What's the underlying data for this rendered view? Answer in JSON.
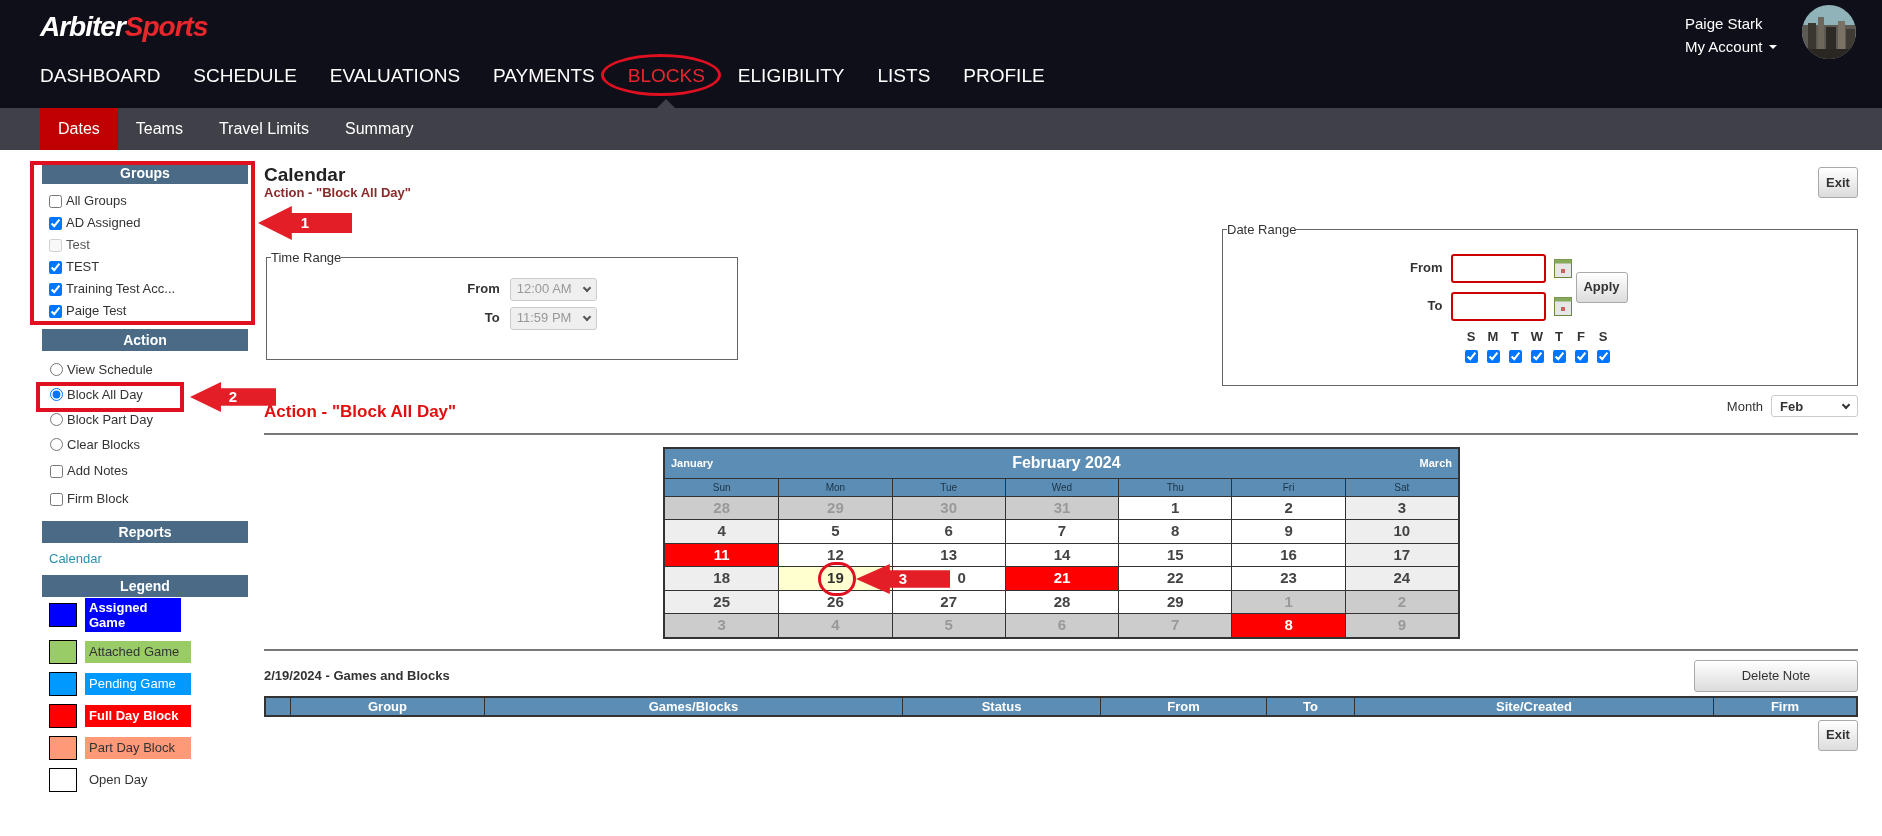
{
  "header": {
    "logo": {
      "first": "Arbiter",
      "second": "Sports"
    },
    "nav": [
      {
        "label": "DASHBOARD",
        "selected": false
      },
      {
        "label": "SCHEDULE",
        "selected": false
      },
      {
        "label": "EVALUATIONS",
        "selected": false
      },
      {
        "label": "PAYMENTS",
        "selected": false
      },
      {
        "label": "BLOCKS",
        "selected": true
      },
      {
        "label": "ELIGIBILITY",
        "selected": false
      },
      {
        "label": "LISTS",
        "selected": false
      },
      {
        "label": "PROFILE",
        "selected": false
      }
    ],
    "user": {
      "name": "Paige Stark",
      "account": "My Account"
    }
  },
  "subnav": [
    {
      "label": "Dates",
      "selected": true
    },
    {
      "label": "Teams",
      "selected": false
    },
    {
      "label": "Travel Limits",
      "selected": false
    },
    {
      "label": "Summary",
      "selected": false
    }
  ],
  "sidebar": {
    "groups": {
      "title": "Groups",
      "items": [
        {
          "label": "All Groups",
          "checked": false,
          "disabled": false
        },
        {
          "label": "AD Assigned",
          "checked": true,
          "disabled": false
        },
        {
          "label": "Test",
          "checked": false,
          "disabled": true
        },
        {
          "label": "TEST",
          "checked": true,
          "disabled": false
        },
        {
          "label": "Training Test Acc...",
          "checked": true,
          "disabled": false
        },
        {
          "label": "Paige Test",
          "checked": true,
          "disabled": false
        }
      ]
    },
    "action": {
      "title": "Action",
      "items": [
        {
          "kind": "radio",
          "label": "View Schedule",
          "selected": false
        },
        {
          "kind": "radio",
          "label": "Block All Day",
          "selected": true
        },
        {
          "kind": "radio",
          "label": "Block Part Day",
          "selected": false
        },
        {
          "kind": "radio",
          "label": "Clear Blocks",
          "selected": false
        },
        {
          "kind": "checkbox",
          "label": "Add Notes",
          "checked": false
        },
        {
          "kind": "checkbox",
          "label": "Firm Block",
          "checked": false
        }
      ]
    },
    "reports": {
      "title": "Reports",
      "links": [
        "Calendar"
      ]
    },
    "legend": {
      "title": "Legend",
      "items": [
        {
          "label": "Assigned Game",
          "color": "#0000ff"
        },
        {
          "label": "Attached Game",
          "color": "#99cc66"
        },
        {
          "label": "Pending Game",
          "color": "#0099ff"
        },
        {
          "label": "Full Day Block",
          "color": "#ff0000"
        },
        {
          "label": "Part Day Block",
          "color": "#ff9977"
        },
        {
          "label": "Open Day",
          "color": "#ffffff"
        }
      ]
    }
  },
  "main": {
    "title": "Calendar",
    "subtitle": "Action - \"Block All Day\"",
    "exit": "Exit",
    "time_range": {
      "legend": "Time Range",
      "from": {
        "label": "From",
        "value": "12:00 AM",
        "disabled": true
      },
      "to": {
        "label": "To",
        "value": "11:59 PM",
        "disabled": true
      }
    },
    "date_range": {
      "legend": "Date Range",
      "from_label": "From",
      "to_label": "To",
      "apply": "Apply",
      "days": [
        {
          "letter": "S",
          "checked": true
        },
        {
          "letter": "M",
          "checked": true
        },
        {
          "letter": "T",
          "checked": true
        },
        {
          "letter": "W",
          "checked": true
        },
        {
          "letter": "T",
          "checked": true
        },
        {
          "letter": "F",
          "checked": true
        },
        {
          "letter": "S",
          "checked": true
        }
      ]
    },
    "action_heading": "Action - \"Block All Day\"",
    "month": {
      "label": "Month",
      "value": "Feb"
    },
    "calendar": {
      "prev": "January",
      "title": "February 2024",
      "next": "March",
      "weekdays": [
        "Sun",
        "Mon",
        "Tue",
        "Wed",
        "Thu",
        "Fri",
        "Sat"
      ],
      "weeks": [
        [
          {
            "day": "28",
            "kind": "other"
          },
          {
            "day": "29",
            "kind": "other"
          },
          {
            "day": "30",
            "kind": "other"
          },
          {
            "day": "31",
            "kind": "other"
          },
          {
            "day": "1",
            "kind": "weekday"
          },
          {
            "day": "2",
            "kind": "weekday"
          },
          {
            "day": "3",
            "kind": "weekend"
          }
        ],
        [
          {
            "day": "4",
            "kind": "weekend"
          },
          {
            "day": "5",
            "kind": "weekday"
          },
          {
            "day": "6",
            "kind": "weekday"
          },
          {
            "day": "7",
            "kind": "weekday"
          },
          {
            "day": "8",
            "kind": "weekday"
          },
          {
            "day": "9",
            "kind": "weekday"
          },
          {
            "day": "10",
            "kind": "weekend"
          }
        ],
        [
          {
            "day": "11",
            "kind": "block"
          },
          {
            "day": "12",
            "kind": "weekday"
          },
          {
            "day": "13",
            "kind": "weekday"
          },
          {
            "day": "14",
            "kind": "weekday"
          },
          {
            "day": "15",
            "kind": "weekday"
          },
          {
            "day": "16",
            "kind": "weekday"
          },
          {
            "day": "17",
            "kind": "weekend"
          }
        ],
        [
          {
            "day": "18",
            "kind": "weekend"
          },
          {
            "day": "19",
            "kind": "today"
          },
          {
            "day": "0",
            "kind": "weekday"
          },
          {
            "day": "21",
            "kind": "block"
          },
          {
            "day": "22",
            "kind": "weekday"
          },
          {
            "day": "23",
            "kind": "weekday"
          },
          {
            "day": "24",
            "kind": "weekend"
          }
        ],
        [
          {
            "day": "25",
            "kind": "weekend"
          },
          {
            "day": "26",
            "kind": "weekday"
          },
          {
            "day": "27",
            "kind": "weekday"
          },
          {
            "day": "28",
            "kind": "weekday"
          },
          {
            "day": "29",
            "kind": "weekday"
          },
          {
            "day": "1",
            "kind": "other"
          },
          {
            "day": "2",
            "kind": "other"
          }
        ],
        [
          {
            "day": "3",
            "kind": "other"
          },
          {
            "day": "4",
            "kind": "other"
          },
          {
            "day": "5",
            "kind": "other"
          },
          {
            "day": "6",
            "kind": "other"
          },
          {
            "day": "7",
            "kind": "other"
          },
          {
            "day": "8",
            "kind": "block"
          },
          {
            "day": "9",
            "kind": "other"
          }
        ]
      ]
    },
    "games": {
      "title": "2/19/2024 - Games and Blocks",
      "delete_button": "Delete Note",
      "columns": [
        "Group",
        "Games/Blocks",
        "Status",
        "From",
        "To",
        "Site/Created",
        "Firm"
      ],
      "exit": "Exit"
    }
  },
  "annotations": [
    {
      "label": "1"
    },
    {
      "label": "2"
    },
    {
      "label": "3"
    }
  ]
}
